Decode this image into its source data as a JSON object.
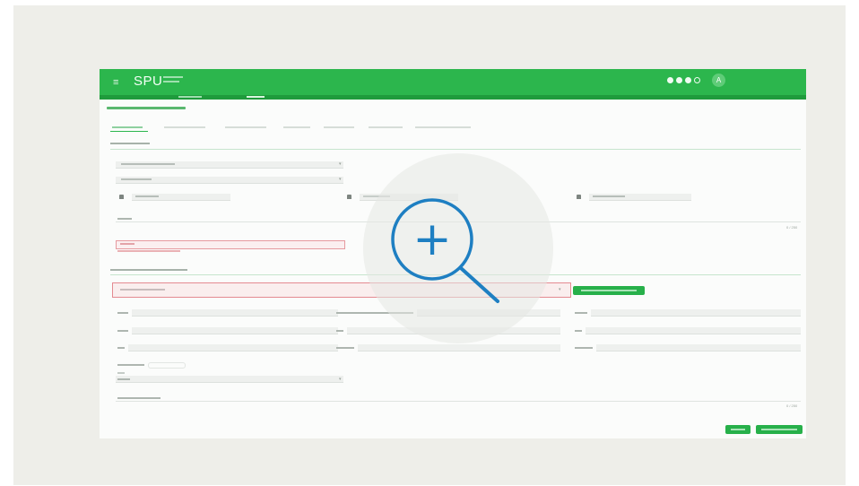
{
  "header": {
    "menu_glyph": "≡",
    "logo_text": "SPU",
    "avatar_text": "A"
  },
  "colors": {
    "brand_green": "#2cb64d",
    "error_red": "#e69a9f",
    "zoom_blue": "#1e7fc2",
    "frame_bg": "#eeeee9"
  },
  "form": {
    "selects": [
      {
        "caret": "▾"
      },
      {
        "caret": "▾"
      }
    ],
    "counter_1": "0 / 250",
    "counter_2": "0 / 250",
    "search_caret": "▾"
  },
  "zoom_icon": {
    "glyph": "+"
  }
}
